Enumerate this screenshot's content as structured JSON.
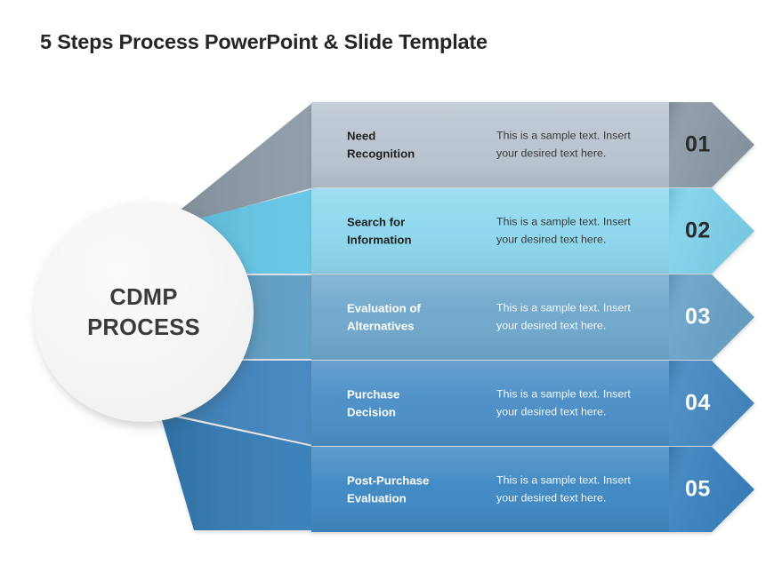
{
  "slide": {
    "title": "5 Steps Process PowerPoint & Slide Template",
    "background_color": "#ffffff"
  },
  "center": {
    "label": "CDMP\nPROCESS",
    "fill_color": "#f4f4f4",
    "text_color": "#3a3a3a"
  },
  "steps": [
    {
      "number": "01",
      "title": "Need\nRecognition",
      "description": "This is a sample text. Insert your desired text here.",
      "body_color": "#bac5d0",
      "number_block_color": "#8b9aa7",
      "wing_color": "#8b9aa7",
      "text_mode": "dark"
    },
    {
      "number": "02",
      "title": "Search for\nInformation",
      "description": "This is a sample text. Insert your desired text here.",
      "body_color": "#8ed8ef",
      "number_block_color": "#7fd2ec",
      "wing_color": "#62c6e6",
      "text_mode": "dark"
    },
    {
      "number": "03",
      "title": "Evaluation of\nAlternatives",
      "description": "This is a sample text. Insert your desired text here.",
      "body_color": "#6fa8cc",
      "number_block_color": "#6aa3c8",
      "wing_color": "#5d9ec5",
      "text_mode": "light"
    },
    {
      "number": "04",
      "title": "Purchase\nDecision",
      "description": "This is a sample text. Insert your desired text here.",
      "body_color": "#4b8fc7",
      "number_block_color": "#4589c2",
      "wing_color": "#3f84bf",
      "text_mode": "light"
    },
    {
      "number": "05",
      "title": "Post-Purchase\nEvaluation",
      "description": "This is a sample text. Insert your desired text here.",
      "body_color": "#4189c4",
      "number_block_color": "#3b83bf",
      "wing_color": "#337db8",
      "text_mode": "light"
    }
  ]
}
